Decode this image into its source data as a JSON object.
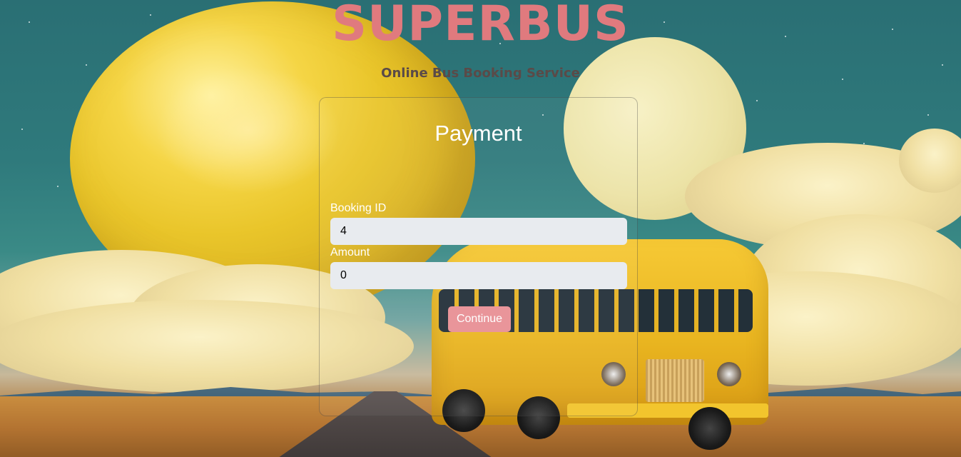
{
  "header": {
    "title": "SUPERBUS",
    "subtitle": "Online Bus Booking Service"
  },
  "form": {
    "title": "Payment",
    "fields": [
      {
        "label": "Booking ID",
        "value": "4"
      },
      {
        "label": "Amount",
        "value": "0"
      }
    ],
    "submit_label": "Continue"
  },
  "colors": {
    "brand": "#e07a7e",
    "button": "#e9959a",
    "input_bg": "#e8ebef"
  }
}
